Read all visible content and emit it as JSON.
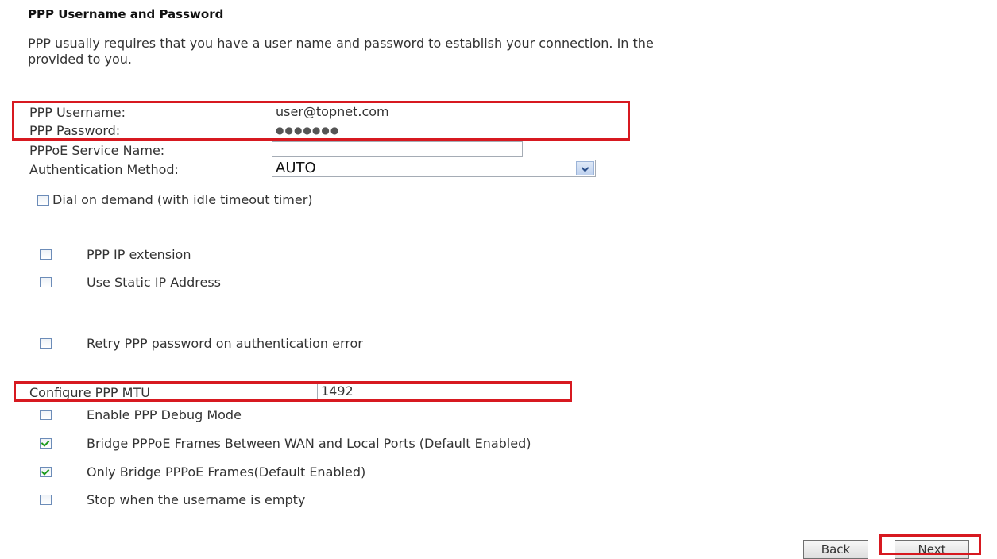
{
  "title": "PPP Username and Password",
  "description_line1": "PPP usually requires that you have a user name and password to establish your connection. In the",
  "description_line2": "provided to you.",
  "fields": {
    "username_label": "PPP Username:",
    "username_value": "user@topnet.com",
    "password_label": "PPP Password:",
    "password_value": "●●●●●●●",
    "service_label": "PPPoE Service Name:",
    "service_value": "",
    "auth_label": "Authentication Method:",
    "auth_value": "AUTO",
    "mtu_label": "Configure PPP MTU",
    "mtu_value": "1492"
  },
  "options": {
    "dial_on_demand": {
      "label": "Dial on demand (with idle timeout timer)",
      "checked": false
    },
    "ip_extension": {
      "label": "PPP IP extension",
      "checked": false
    },
    "static_ip": {
      "label": "Use Static IP Address",
      "checked": false
    },
    "retry_password": {
      "label": "Retry PPP password on authentication error",
      "checked": false
    },
    "debug_mode": {
      "label": "Enable PPP Debug Mode",
      "checked": false
    },
    "bridge_frames": {
      "label": "Bridge PPPoE Frames Between WAN and Local Ports (Default Enabled)",
      "checked": true
    },
    "only_bridge": {
      "label": "Only Bridge PPPoE Frames(Default Enabled)",
      "checked": true
    },
    "stop_empty": {
      "label": "Stop when the username is empty",
      "checked": false
    }
  },
  "buttons": {
    "back": "Back",
    "next": "Next"
  },
  "highlight_color": "#d71920"
}
